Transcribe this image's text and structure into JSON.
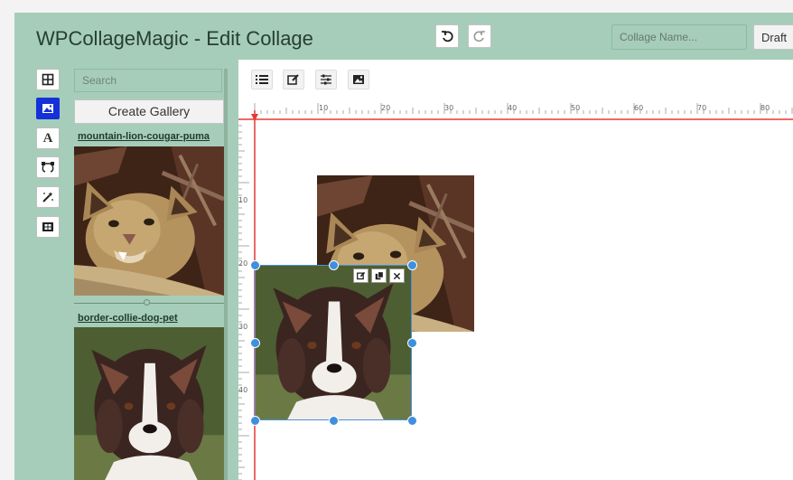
{
  "header": {
    "title": "WPCollageMagic - Edit Collage",
    "collage_name_placeholder": "Collage Name...",
    "status_label": "Draft"
  },
  "sidebar": {
    "search_placeholder": "Search",
    "create_gallery_label": "Create Gallery",
    "tools": [
      {
        "name": "layout-icon"
      },
      {
        "name": "image-icon",
        "active": true
      },
      {
        "name": "text-icon",
        "glyph": "A"
      },
      {
        "name": "vector-path-icon"
      },
      {
        "name": "magic-wand-icon"
      },
      {
        "name": "film-icon"
      }
    ],
    "items": [
      {
        "label": "mountain-lion-cougar-puma"
      },
      {
        "label": "border-collie-dog-pet"
      }
    ]
  },
  "workspace": {
    "toolbar": [
      "list-icon",
      "edit-icon",
      "sliders-icon",
      "image-icon"
    ],
    "ruler": {
      "h_labels": [
        "10",
        "20",
        "30",
        "40",
        "50",
        "60",
        "70",
        "80"
      ],
      "v_labels": [
        "10",
        "20",
        "30",
        "40"
      ]
    },
    "selected_actions": [
      "edit-icon",
      "copy-icon",
      "close-icon"
    ]
  },
  "colors": {
    "app_bg": "#a6cdb9",
    "active_tool": "#1432d8",
    "guide_line": "#e53935",
    "selection": "#4a90d9"
  }
}
